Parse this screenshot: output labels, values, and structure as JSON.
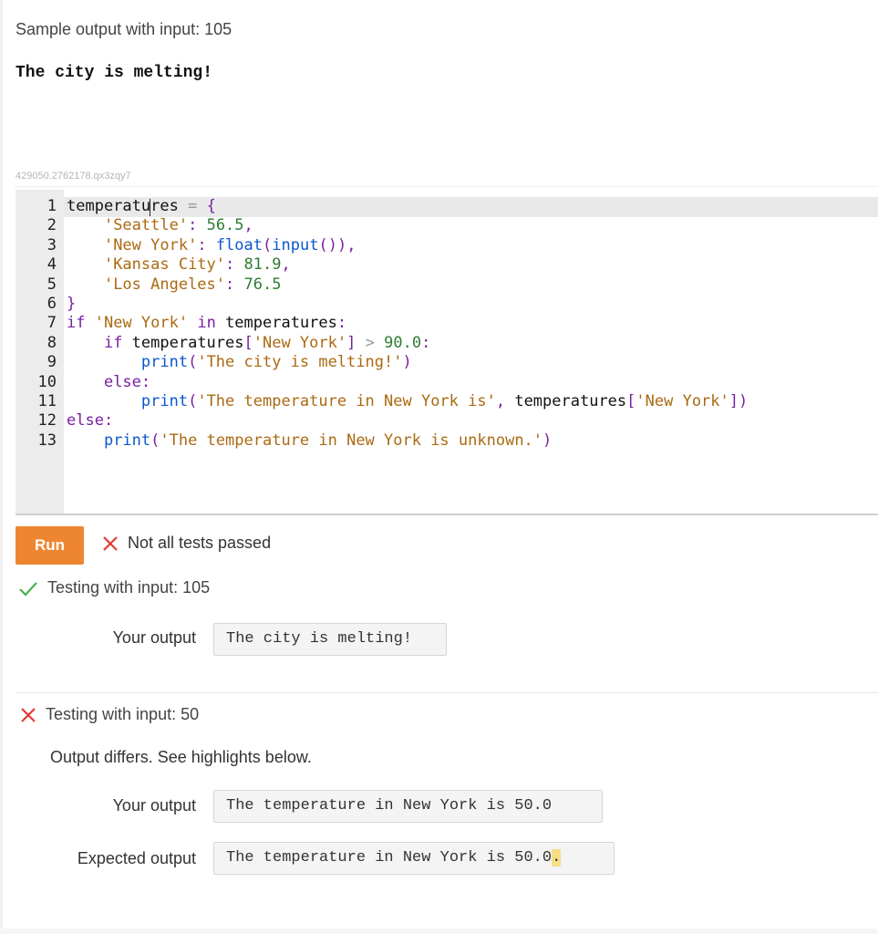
{
  "sample": {
    "label": "Sample output with input: 105",
    "output": "The city is melting!"
  },
  "challenge_id": "429050.2762178.qx3zqy7",
  "editor": {
    "lines": [
      {
        "num": "1",
        "text": "temperatures = {"
      },
      {
        "num": "2",
        "text": "    'Seattle': 56.5,"
      },
      {
        "num": "3",
        "text": "    'New York': float(input()),"
      },
      {
        "num": "4",
        "text": "    'Kansas City': 81.9,"
      },
      {
        "num": "5",
        "text": "    'Los Angeles': 76.5"
      },
      {
        "num": "6",
        "text": "}"
      },
      {
        "num": "7",
        "text": "if 'New York' in temperatures:"
      },
      {
        "num": "8",
        "text": "    if temperatures['New York'] > 90.0:"
      },
      {
        "num": "9",
        "text": "        print('The city is melting!')"
      },
      {
        "num": "10",
        "text": "    else:"
      },
      {
        "num": "11",
        "text": "        print('The temperature in New York is', temperatures['New York'])"
      },
      {
        "num": "12",
        "text": "else:"
      },
      {
        "num": "13",
        "text": "    print('The temperature in New York is unknown.')"
      }
    ]
  },
  "run_button": {
    "label": "Run",
    "color": "#ee8631"
  },
  "status": {
    "text": "Not all tests passed",
    "icon": "x-icon",
    "color": "#e53935"
  },
  "tests": [
    {
      "title": "Testing with input: 105",
      "passed": true,
      "icon": "check-icon",
      "your_output_label": "Your output",
      "your_output": "The city is melting!"
    },
    {
      "title": "Testing with input: 50",
      "passed": false,
      "icon": "x-icon",
      "message": "Output differs. See highlights below.",
      "your_output_label": "Your output",
      "your_output": "The temperature in New York is 50.0",
      "expected_output_label": "Expected output",
      "expected_output": "The temperature in New York is 50.0",
      "expected_highlight": "."
    }
  ]
}
